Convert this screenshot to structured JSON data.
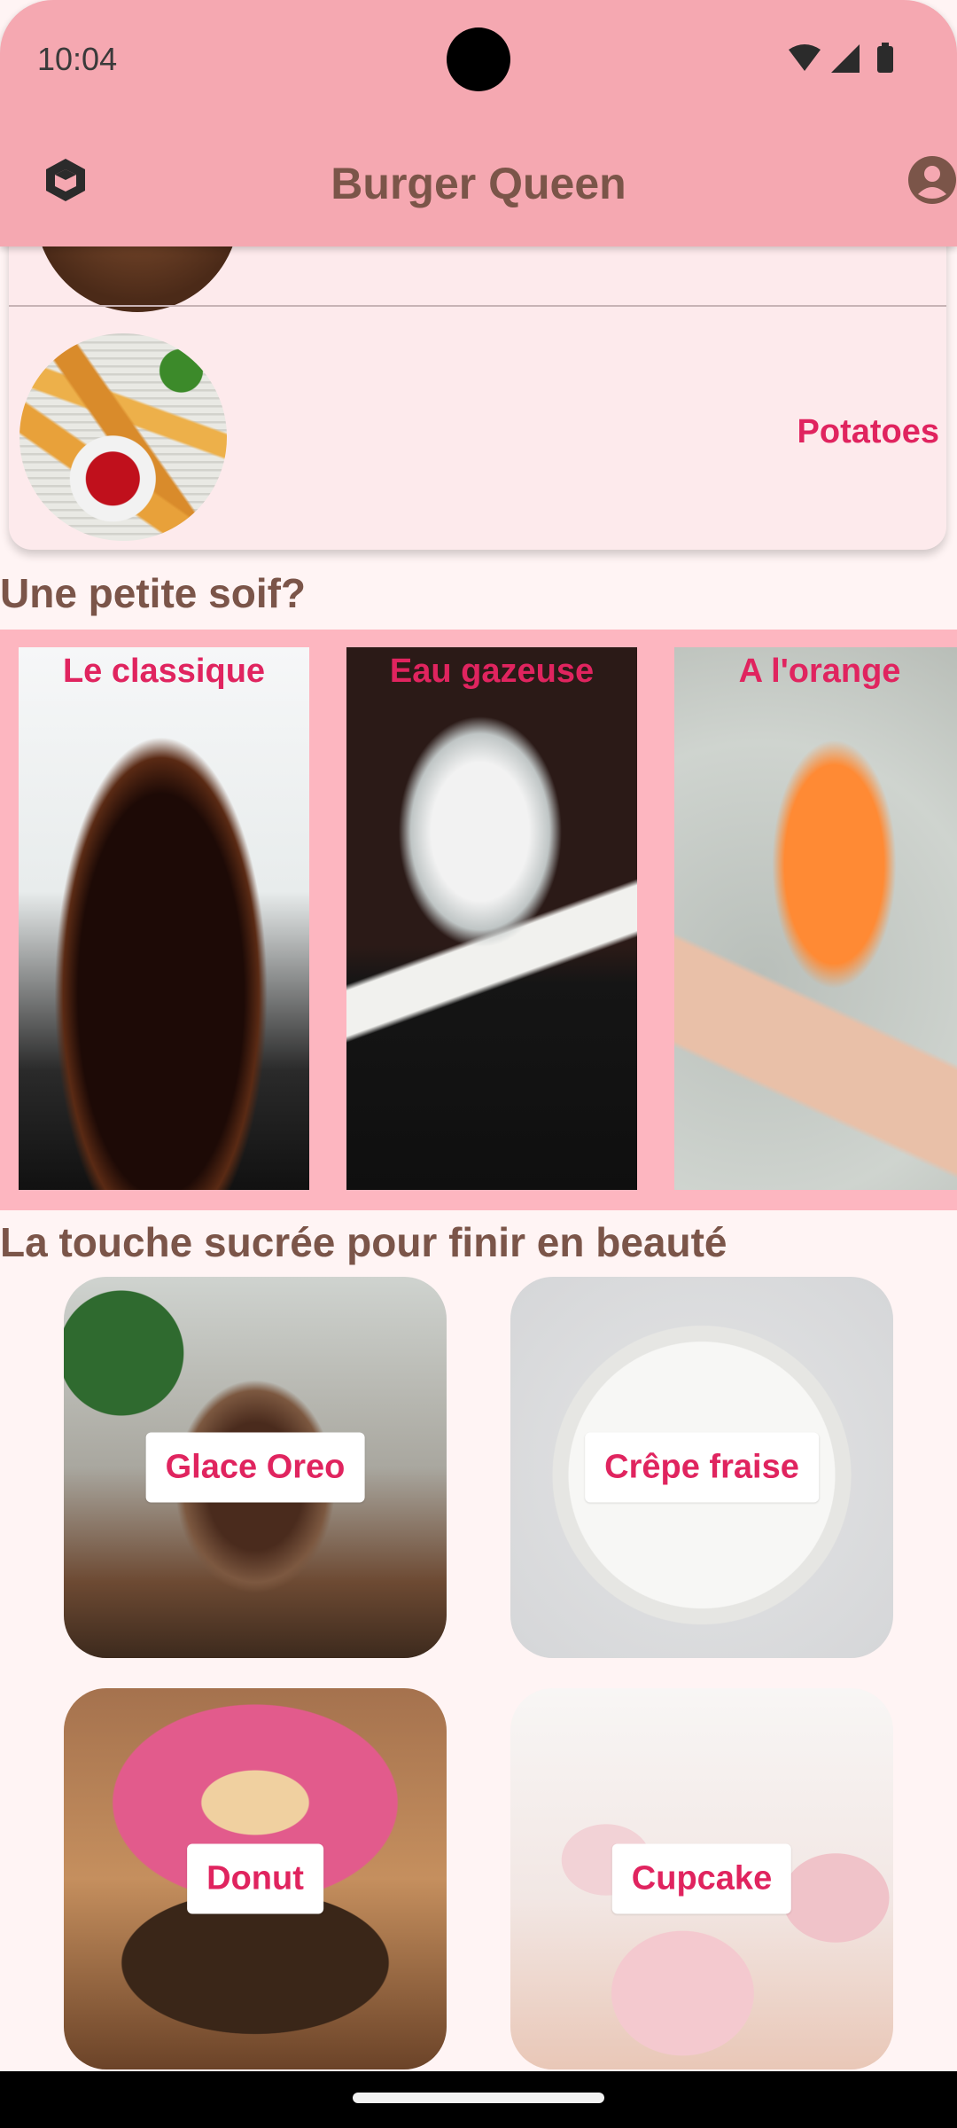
{
  "status_bar": {
    "time": "10:04",
    "icons": [
      "wifi-icon",
      "signal-icon",
      "battery-icon"
    ]
  },
  "app_bar": {
    "title": "Burger Queen",
    "left_icon": "logo-cube-icon",
    "right_icon": "account-circle-icon"
  },
  "menu_list": {
    "items": [
      {
        "label": "Potatoes",
        "image": "potatoes-photo"
      }
    ]
  },
  "drinks": {
    "title": "Une petite soif?",
    "items": [
      {
        "label": "Le classique"
      },
      {
        "label": "Eau gazeuse"
      },
      {
        "label": "A l'orange"
      }
    ]
  },
  "desserts": {
    "title": "La touche sucrée pour finir en beauté",
    "items": [
      {
        "label": "Glace Oreo"
      },
      {
        "label": "Crêpe fraise"
      },
      {
        "label": "Donut"
      },
      {
        "label": "Cupcake"
      }
    ]
  },
  "colors": {
    "app_bar": "#f5a8b1",
    "accent_text": "#e0245f",
    "heading_text": "#7b5549",
    "background": "#fff4f4",
    "drinks_band": "#fdb6c0"
  }
}
